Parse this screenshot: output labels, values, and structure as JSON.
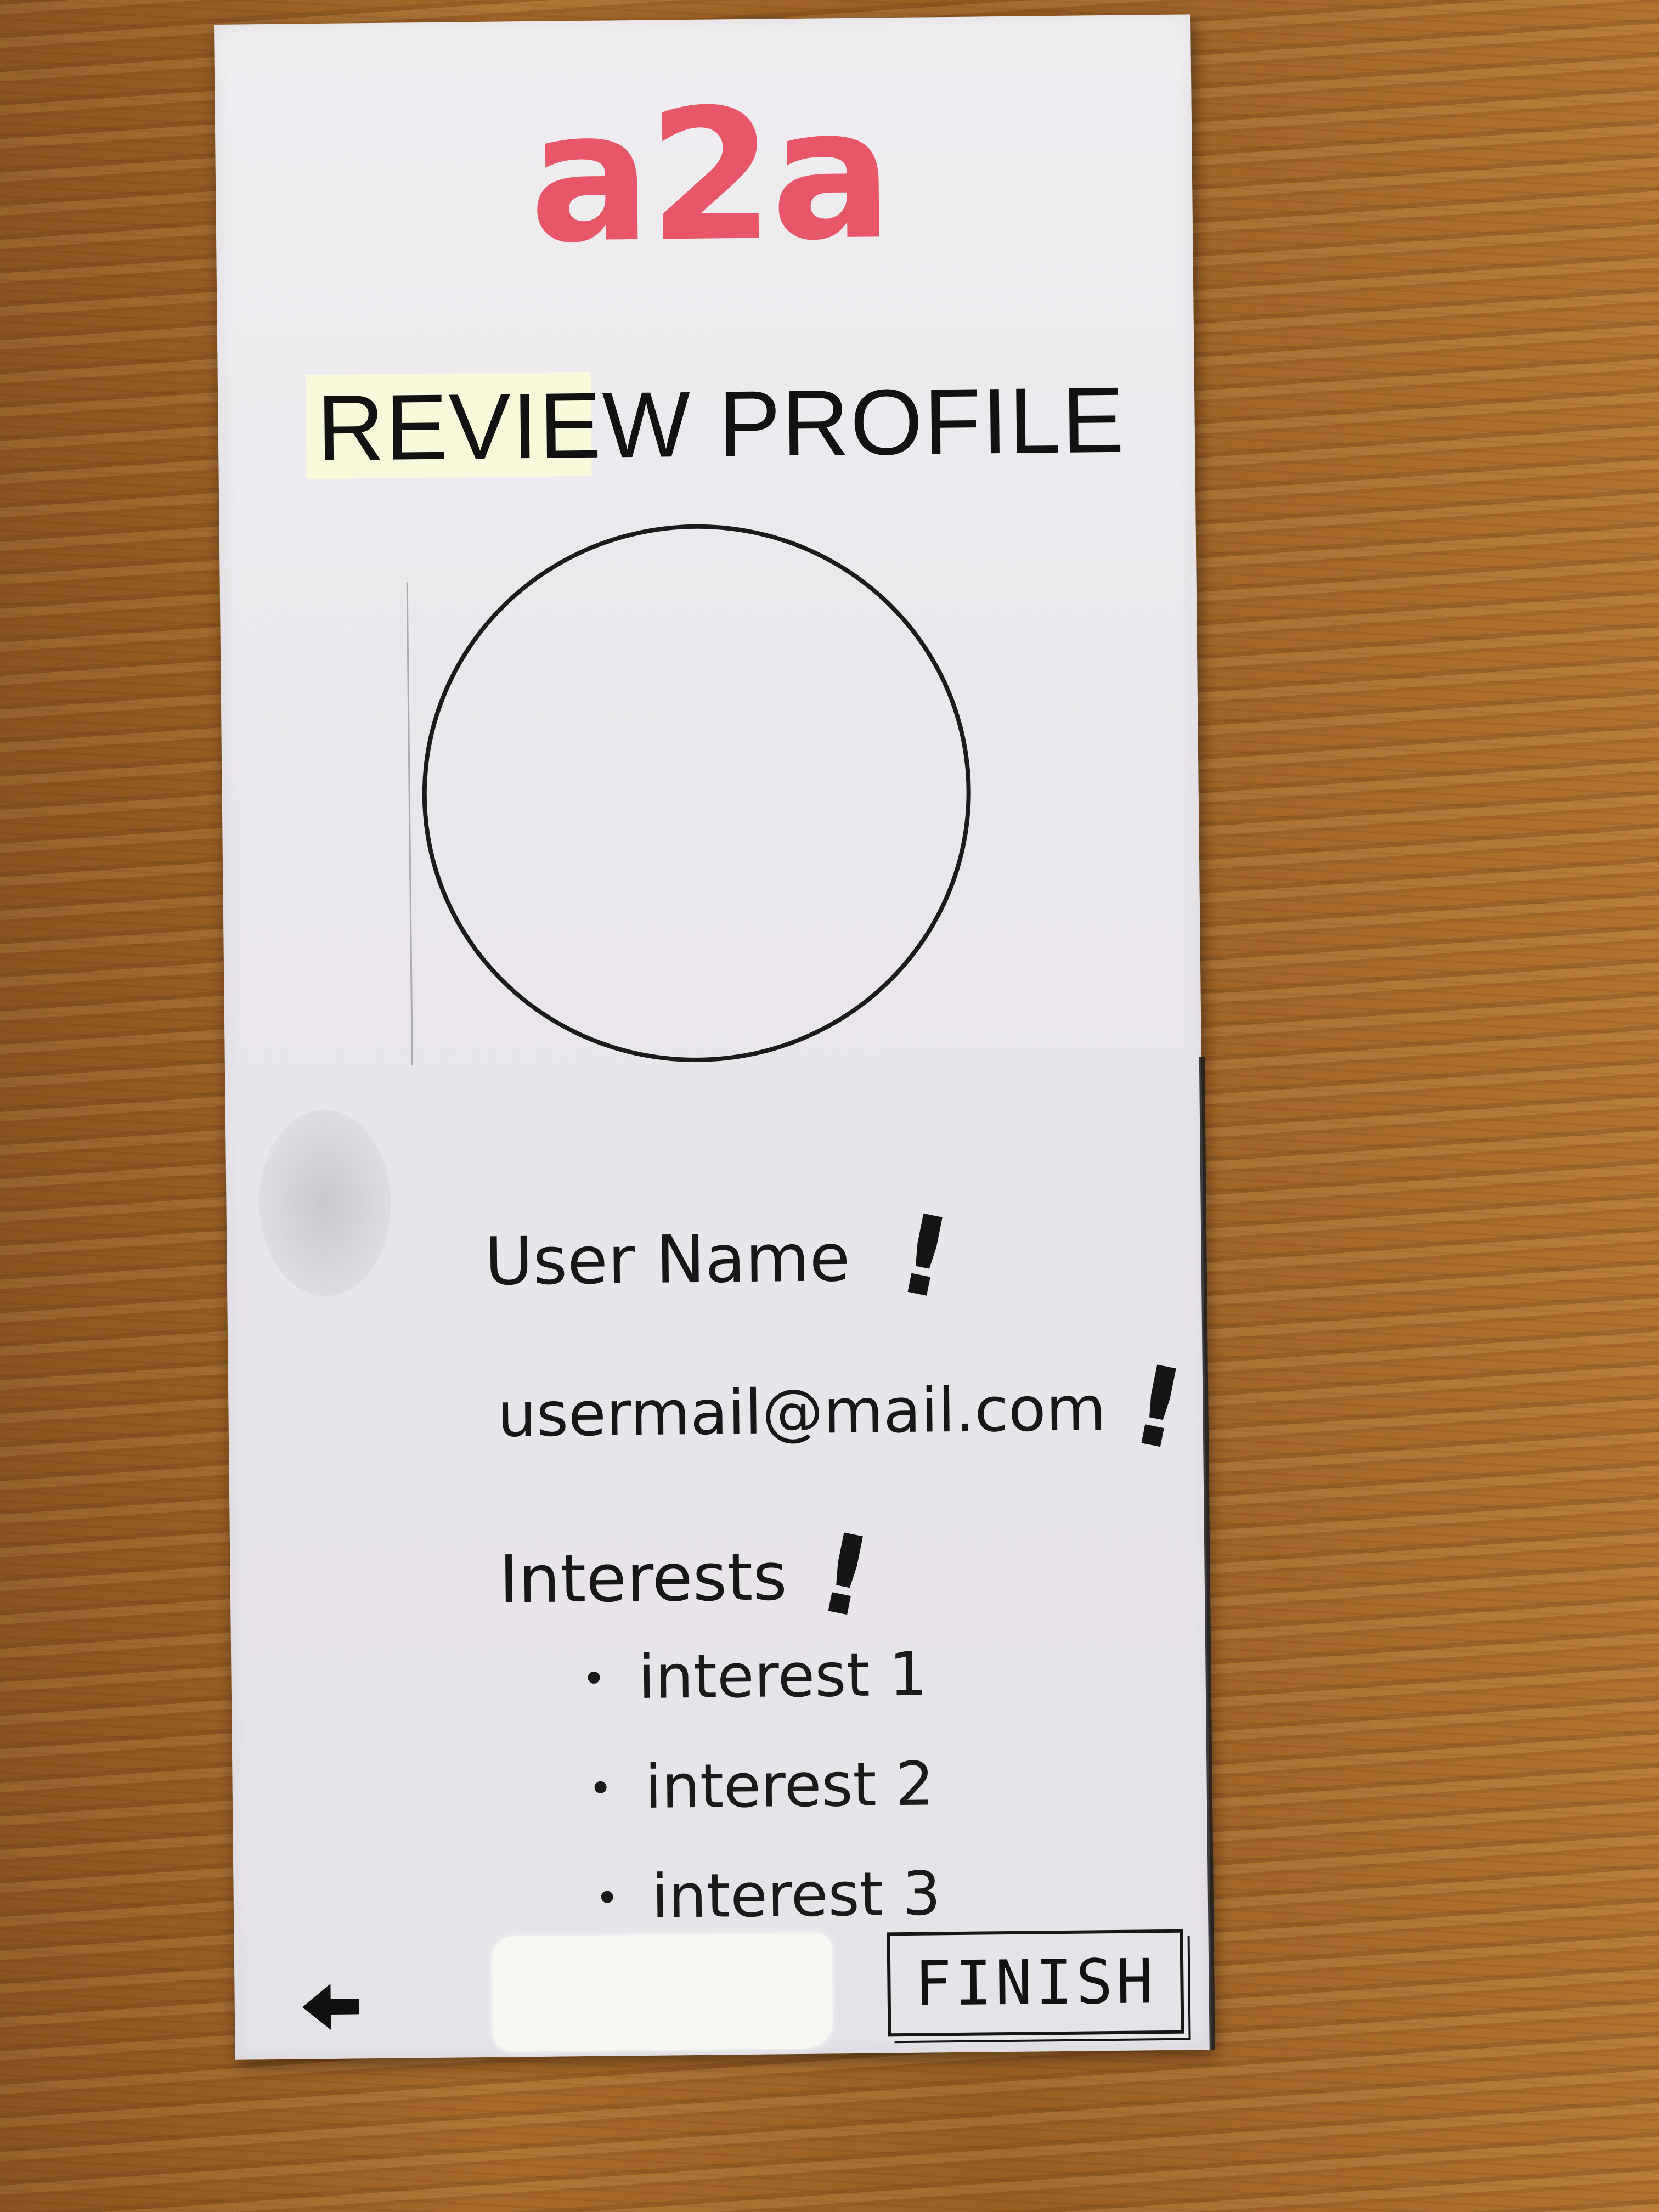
{
  "app": {
    "logo": "a2a",
    "logo_color": "#e8566a"
  },
  "header": {
    "title": "REVIEW PROFILE"
  },
  "profile": {
    "avatar_icon": "avatar-placeholder-circle",
    "name": "User Name",
    "email": "usermail@mail.com",
    "interests_label": "Interests",
    "interests": [
      "interest 1",
      "interest 2",
      "interest 3"
    ],
    "flag_mark": "!"
  },
  "footer": {
    "back_icon": "back-arrow-icon",
    "finish_label": "FINISH"
  }
}
